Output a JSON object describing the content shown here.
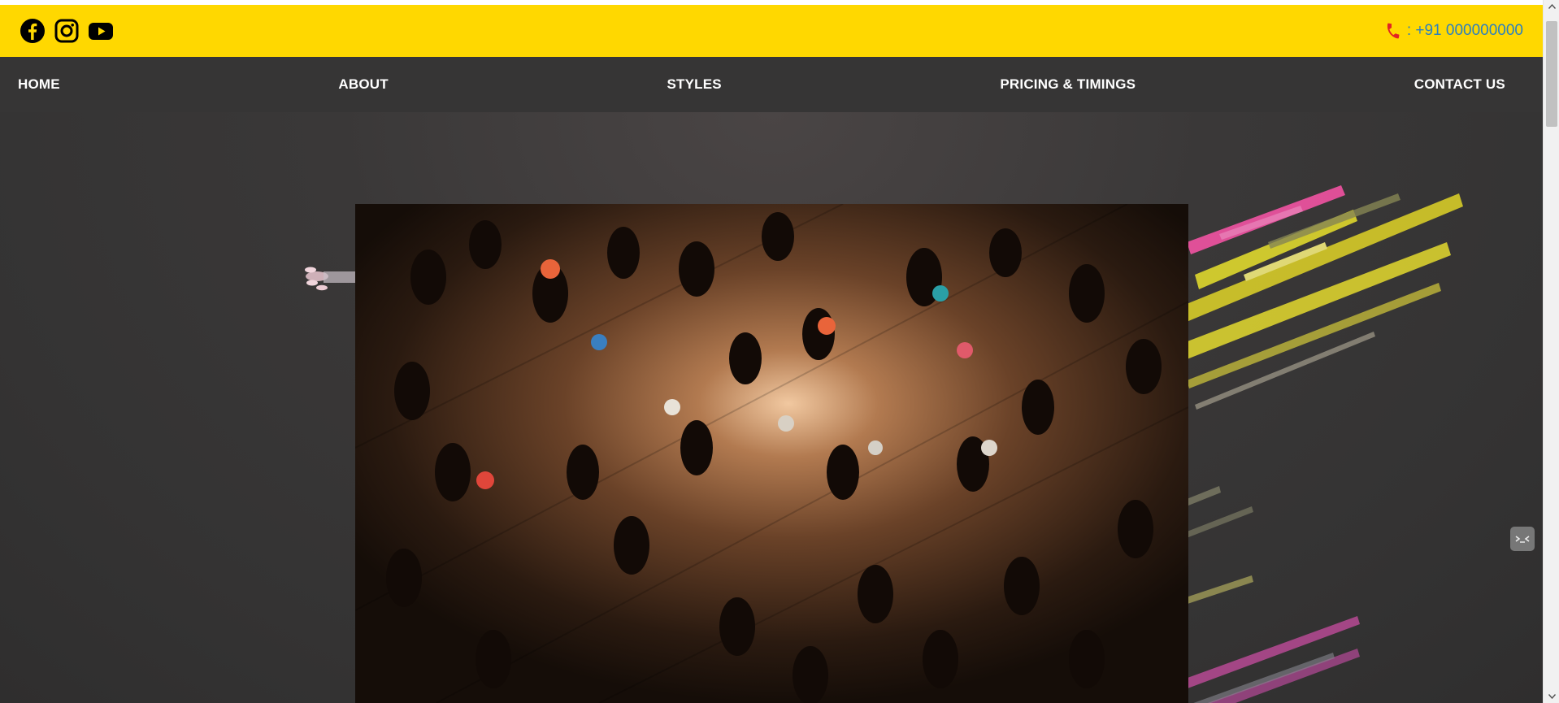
{
  "header": {
    "social": [
      {
        "name": "facebook-icon"
      },
      {
        "name": "instagram-icon"
      },
      {
        "name": "youtube-icon"
      }
    ],
    "phone_icon": "phone-icon",
    "phone_text": ": +91 000000000"
  },
  "nav": {
    "items": [
      {
        "label": "HOME"
      },
      {
        "label": "ABOUT"
      },
      {
        "label": "STYLES"
      },
      {
        "label": "PRICING & TIMINGS"
      },
      {
        "label": "CONTACT US"
      }
    ]
  },
  "colors": {
    "topbar_bg": "#ffd800",
    "navbar_bg": "#363535",
    "phone_text": "#2a7fc0",
    "phone_icon": "#e22424",
    "hero_bg": "#343333",
    "streak_pink": "#e8529e",
    "streak_yellow": "#d6d02e"
  },
  "hero": {
    "image": "dance-floor-crowd-photo",
    "decoration": "colored-streaks-art"
  },
  "widgets": {
    "chat": "chat-face-icon"
  }
}
